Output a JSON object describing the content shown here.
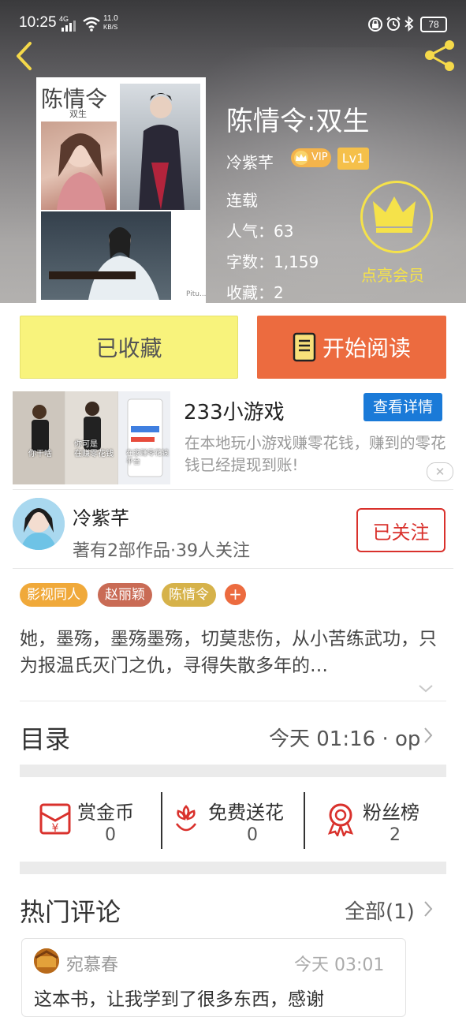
{
  "status_bar": {
    "time": "10:25",
    "signal": "4G",
    "net_speed_value": "11.0",
    "net_speed_unit": "KB/S",
    "battery": "78"
  },
  "book": {
    "title": "陈情令:双生",
    "author": "冷紫芊",
    "vip_badge": "VIP",
    "level_badge": "Lv1",
    "status": "连载",
    "popularity": "人气：63",
    "words": "字数：1,159",
    "favorites": "收藏：2",
    "cover_title": "陈情令",
    "cover_subtitle": "双生",
    "cover_watermark": "Pitu..."
  },
  "membership": {
    "label": "点亮会员"
  },
  "actions": {
    "favorited_label": "已收藏",
    "read_label": "开始阅读"
  },
  "ad": {
    "title": "233小游戏",
    "cta": "查看详情",
    "description": "在本地玩小游戏赚零花钱，赚到的零花钱已经提现到账!",
    "close": "✕",
    "thumb_texts": [
      "你干啥",
      "你可是\n在赚零花钱",
      "在家赚零花钱\n平台"
    ]
  },
  "author_card": {
    "name": "冷紫芊",
    "info": "著有2部作品·39人关注",
    "follow_label": "已关注"
  },
  "tags": [
    {
      "label": "影视同人",
      "color": "#f0a93a"
    },
    {
      "label": "赵丽颖",
      "color": "#c96b55"
    },
    {
      "label": "陈情令",
      "color": "#d6b24a"
    }
  ],
  "tag_add": "+",
  "description": "她，墨殇，墨殇墨殇，切莫悲伤，从小苦练武功，只为报温氏灭门之仇，寻得失散多年的…",
  "catalog": {
    "title": "目录",
    "update": "今天 01:16 · op"
  },
  "rewards": [
    {
      "label": "赏金币",
      "count": "0"
    },
    {
      "label": "免费送花",
      "count": "0"
    },
    {
      "label": "粉丝榜",
      "count": "2"
    }
  ],
  "comments": {
    "title": "热门评论",
    "all_label": "全部(1)",
    "items": [
      {
        "user": "宛慕春",
        "time": "今天 03:01",
        "text": "这本书，让我学到了很多东西，感谢"
      }
    ]
  },
  "colors": {
    "accent_orange": "#ec6b3f",
    "follow_red": "#d9312c",
    "gold": "#f5e24a",
    "ad_blue": "#1a7ad8"
  }
}
